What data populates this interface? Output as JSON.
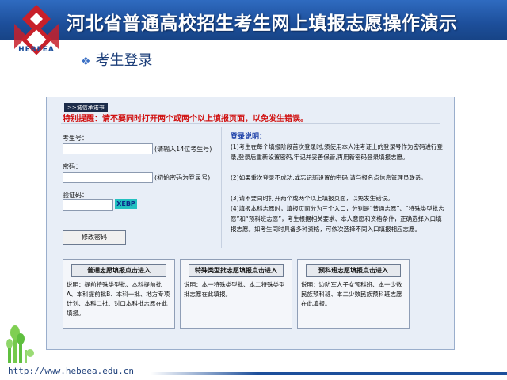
{
  "header": {
    "title": "河北省普通高校招生考生网上填报志愿操作演示",
    "logo_text": "HEBEEA"
  },
  "subheading": "考生登录",
  "panel": {
    "tab_label": ">>诚信承诺书",
    "warning": "特别提醒：请不要同时打开两个或两个以上填报页面，以免发生错误。",
    "login": {
      "exam_no_label": "考生号：",
      "exam_no_hint": "(请输入14位考生号)",
      "password_label": "密码：",
      "password_hint": "(初始密码为登录号)",
      "captcha_label": "验证码：",
      "captcha_value": "XEBP",
      "change_password_button": "修改密码"
    },
    "notice": {
      "title": "登录说明：",
      "items": [
        "(1)考生在每个填报阶段首次登录时,须使用本人准考证上的登录号作为密码进行登录,登录后重新设置密码,牢记并妥善保管,再用新密码登录填报志愿。",
        "(2)如果重次登录不成功,或忘记新设置的密码,请与报名点信息管理员联系。",
        "(3)请不要同时打开两个或两个以上填报页面，以免发生错误。",
        "(4)填报本科志愿时，填报页面分为三个入口，分别是“普通志愿”、“特殊类型批志愿”和“预科班志愿”，考生根据相关要求、本人意愿和资格条件，正确选择入口填报志愿。如考生同时具备多种资格，可依次选择不同入口填报相应志愿。"
      ]
    },
    "entries": [
      {
        "button": "普通志愿填报点击进入",
        "desc": "说明：提前特殊类型批、本科提前批A、本科提前批B、本科一批、地方专项计划、本科二批、对口本科批志愿在此填报。"
      },
      {
        "button": "特殊类型批志愿填报点击进入",
        "desc": "说明：本一特殊类型批、本二特殊类型批志愿在此填报。"
      },
      {
        "button": "预科班志愿填报点击进入",
        "desc": "说明：边防军人子女预科班、本一少数民族预科班、本二少数民族预科班志愿在此填报。"
      }
    ]
  },
  "footer": {
    "url": "http://www.hebeea.edu.cn"
  },
  "colors": {
    "brand_blue": "#1d4f9b",
    "warning_red": "#d01010",
    "captcha_cyan": "#23c0c0",
    "logo_red": "#c8202a"
  }
}
